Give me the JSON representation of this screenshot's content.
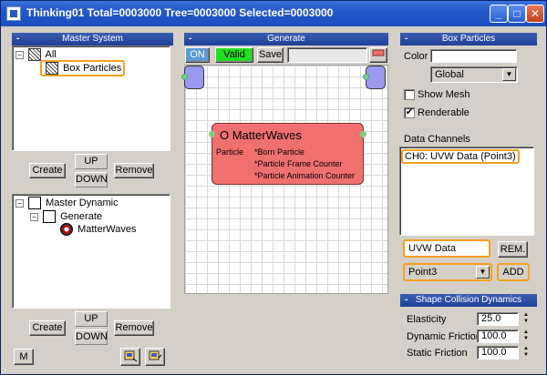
{
  "window": {
    "title": "Thinking01  Total=0003000  Tree=0003000  Selected=0003000"
  },
  "master_system": {
    "header": "Master System",
    "tree": [
      {
        "label": "All"
      },
      {
        "label": "Box Particles"
      }
    ],
    "buttons": {
      "create": "Create",
      "up": "UP",
      "down": "DOWN",
      "remove": "Remove"
    }
  },
  "master_dynamic": {
    "tree": [
      {
        "label": "Master Dynamic"
      },
      {
        "label": "Generate"
      },
      {
        "label": "MatterWaves"
      }
    ],
    "buttons": {
      "create": "Create",
      "up": "UP",
      "down": "DOWN",
      "remove": "Remove",
      "m": "M"
    }
  },
  "generate": {
    "header": "Generate",
    "on": "ON",
    "valid": "Valid",
    "save": "Save",
    "node": {
      "title": "O MatterWaves",
      "port_label": "Particle",
      "outputs": [
        "*Born Particle",
        "*Particle Frame Counter",
        "*Particle Animation Counter"
      ]
    }
  },
  "box_particles": {
    "header": "Box Particles",
    "color_label": "Color",
    "color_value": "",
    "color_mode": "Global",
    "show_mesh": "Show Mesh",
    "renderable": "Renderable",
    "data_channels_label": "Data Channels",
    "channels": [
      "CH0: UVW Data (Point3)"
    ],
    "channel_name": "UVW Data",
    "rem": "REM.",
    "type": "Point3",
    "add": "ADD"
  },
  "shape_collision": {
    "header": "Shape Collision Dynamics",
    "elasticity_label": "Elasticity",
    "elasticity": "25.0",
    "dyn_friction_label": "Dynamic Friction",
    "dyn_friction": "100.0",
    "static_friction_label": "Static Friction",
    "static_friction": "100.0"
  },
  "colors": {
    "accent": "#f5a020",
    "node": "#f07070",
    "valid": "#22dd22",
    "port": "#9999ee"
  }
}
